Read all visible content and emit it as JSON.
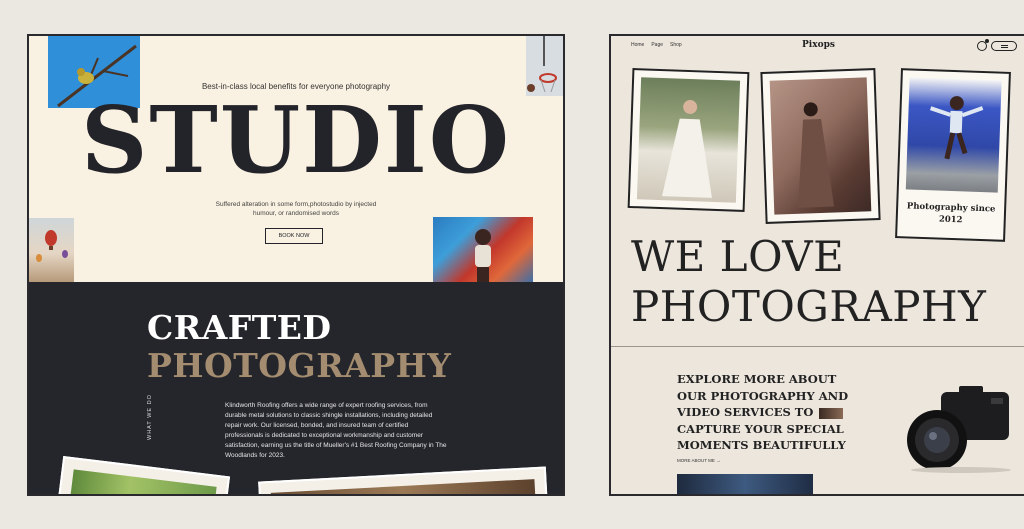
{
  "left": {
    "hero": {
      "tagline": "Best-in-class local benefits for everyone photography",
      "title": "STUDIO",
      "description": "Suffered alteration in some form,photostudio by injected humour, or randomised words",
      "cta_label": "BOOK NOW"
    },
    "dark": {
      "heading_line1": "CRAFTED",
      "heading_line2": "PHOTOGRAPHY",
      "side_label": "WHAT WE DO",
      "description": "Klindworth Roofing offers a wide range of expert roofing services, from durable metal solutions to classic shingle installations, including detailed repair work. Our licensed, bonded, and insured team of certified professionals is dedicated to exceptional workmanship and customer satisfaction, earning us the title of Mueller's #1 Best Roofing Company in The Woodlands for 2023."
    }
  },
  "right": {
    "nav": {
      "items": [
        "Home",
        "Page",
        "Shop"
      ]
    },
    "brand": "Pixops",
    "caption": "Photography since 2012",
    "headline_line1": "WE LOVE",
    "headline_line2": "PHOTOGRAPHY",
    "explore_part1": "EXPLORE MORE ABOUT OUR PHOTOGRAPHY AND VIDEO SERVICES TO",
    "explore_part2": "CAPTURE YOUR SPECIAL MOMENTS BEAUTIFULLY",
    "more_link": "MORE ABOUT ME →"
  },
  "colors": {
    "cream": "#f9f1e1",
    "dark": "#25262c",
    "accent_tan": "#a38c6f",
    "page_bg": "#ebe7e1"
  },
  "icons": [
    "cart-icon",
    "menu-icon",
    "arrow-right-icon"
  ]
}
